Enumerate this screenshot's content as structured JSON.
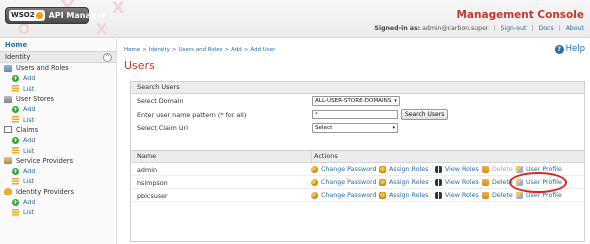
{
  "header": {
    "logo_brand": "WSO2",
    "logo_product": "API Manager",
    "console_title": "Management Console",
    "signed_in_label": "Signed-in as:",
    "signed_in_user": "admin@carbon.super",
    "sign_out": "Sign-out",
    "docs": "Docs",
    "about": "About",
    "separator": "|",
    "title_color": "#c0392b"
  },
  "sidebar": {
    "home": "Home",
    "section": "Identity",
    "groups": [
      {
        "label": "Users and Roles",
        "icon": "users-roles-icon",
        "add": "Add",
        "list": "List"
      },
      {
        "label": "User Stores",
        "icon": "user-store-icon",
        "add": "Add",
        "list": "List"
      },
      {
        "label": "Claims",
        "icon": "claims-icon",
        "add": "Add",
        "list": "List"
      },
      {
        "label": "Service Providers",
        "icon": "service-provider-icon",
        "add": "Add",
        "list": "List"
      },
      {
        "label": "Identity Providers",
        "icon": "identity-provider-icon",
        "add": "Add",
        "list": "List"
      }
    ]
  },
  "main": {
    "breadcrumb": [
      "Home",
      "Identity",
      "Users and Roles",
      "Add",
      "Add User"
    ],
    "breadcrumb_sep": ">",
    "title": "Users",
    "help": "Help",
    "search": {
      "header": "Search Users",
      "domain_label": "Select Domain",
      "domain_value": "ALL-USER-STORE-DOMAINS",
      "pattern_label": "Enter user name pattern (* for all)",
      "pattern_value": "*",
      "search_button": "Search Users",
      "claim_label": "Select Claim Uri",
      "claim_value": "Select"
    },
    "users_table": {
      "col_name": "Name",
      "col_actions": "Actions",
      "actions": {
        "change_password": "Change Password",
        "assign_roles": "Assign Roles",
        "view_roles": "View Roles",
        "delete": "Delete",
        "user_profile": "User Profile"
      },
      "rows": [
        {
          "name": "admin",
          "delete_enabled": false
        },
        {
          "name": "hsimpson",
          "delete_enabled": true,
          "highlighted": true
        },
        {
          "name": "pbicsuser",
          "delete_enabled": true
        }
      ]
    }
  }
}
